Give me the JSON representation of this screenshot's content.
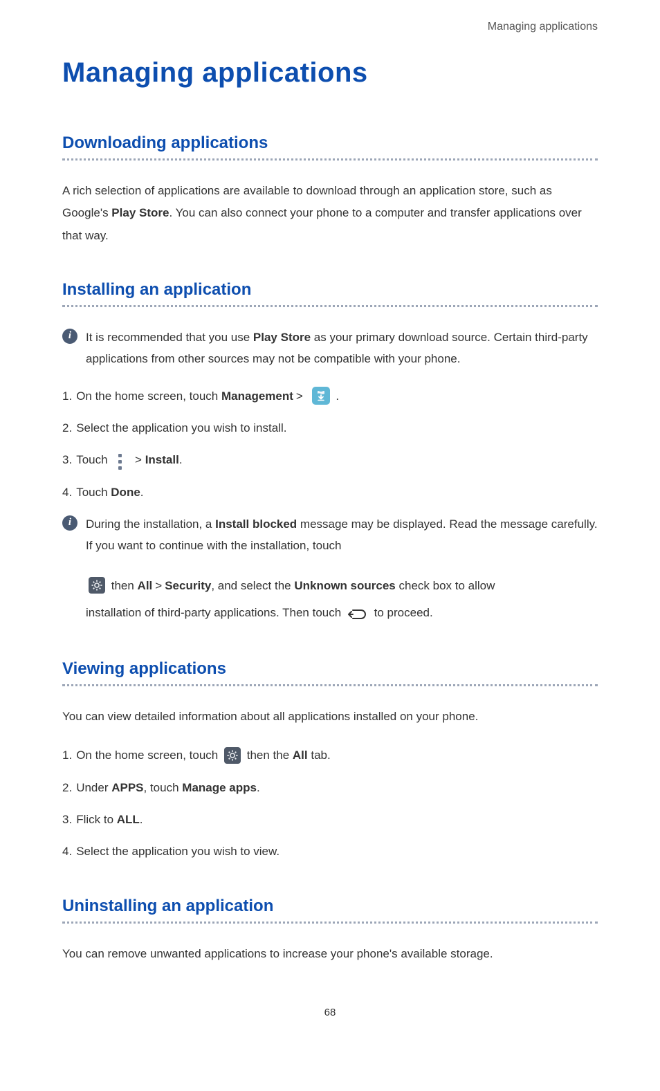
{
  "runningHeader": "Managing applications",
  "pageTitle": "Managing applications",
  "pageNumber": "68",
  "sections": {
    "downloading": {
      "heading": "Downloading applications",
      "body_pre": "A rich selection of applications are available to download through an application store, such as Google's ",
      "body_bold": "Play Store",
      "body_post": ". You can also connect your phone to a computer and transfer applications over that way."
    },
    "installing": {
      "heading": "Installing an application",
      "callout1_pre": "It is recommended that you use ",
      "callout1_bold": "Play Store",
      "callout1_post": " as your primary download source. Certain third-party applications from other sources may not be compatible with your phone.",
      "step1_num": "1.",
      "step1_pre": "On the home screen, touch ",
      "step1_bold": "Management",
      "step1_post": " .",
      "step2_num": "2.",
      "step2_text": "Select the application you wish to install.",
      "step3_num": "3.",
      "step3_pre": "Touch ",
      "step3_bold": "Install",
      "step3_post": ".",
      "step4_num": "4.",
      "step4_pre": "Touch ",
      "step4_bold": "Done",
      "step4_post": ".",
      "callout2_pre": "During the installation, a ",
      "callout2_bold1": "Install blocked",
      "callout2_mid1": " message may be displayed. Read the message carefully. If you want to continue with the installation, touch",
      "callout2_line2_pre": " then ",
      "callout2_bold2": "All",
      "callout2_gt": ">",
      "callout2_bold3": "Security",
      "callout2_mid2": ", and select the ",
      "callout2_bold4": "Unknown sources",
      "callout2_mid3": " check box to allow",
      "callout2_line3_pre": "installation of third-party applications. Then touch ",
      "callout2_line3_post": " to proceed."
    },
    "viewing": {
      "heading": "Viewing applications",
      "body": "You can view detailed information about all applications installed on your phone.",
      "step1_num": "1.",
      "step1_pre": "On the home screen, touch ",
      "step1_mid": " then the ",
      "step1_bold": "All",
      "step1_post": " tab.",
      "step2_num": "2.",
      "step2_pre": "Under ",
      "step2_bold1": "APPS",
      "step2_mid": ", touch ",
      "step2_bold2": "Manage apps",
      "step2_post": ".",
      "step3_num": "3.",
      "step3_pre": "Flick to ",
      "step3_bold": "ALL",
      "step3_post": ".",
      "step4_num": "4.",
      "step4_text": "Select the application you wish to view."
    },
    "uninstalling": {
      "heading": "Uninstalling an application",
      "body": "You can remove unwanted applications to increase your phone's available storage."
    }
  },
  "gt": ">"
}
